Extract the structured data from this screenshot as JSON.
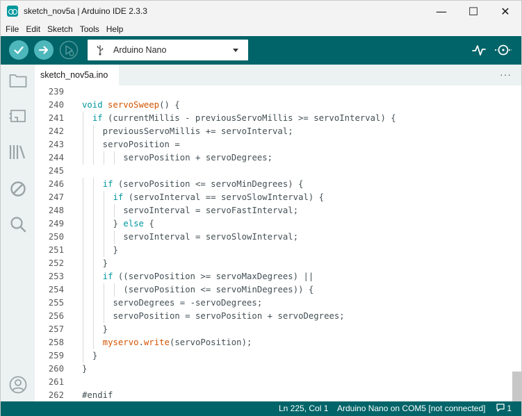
{
  "window": {
    "title": "sketch_nov5a | Arduino IDE 2.3.3",
    "controls": [
      "—",
      "☐",
      "✕"
    ]
  },
  "menu": [
    "File",
    "Edit",
    "Sketch",
    "Tools",
    "Help"
  ],
  "toolbar": {
    "board_name": "Arduino Nano",
    "icons": [
      "verify-icon",
      "upload-icon",
      "debug-icon",
      "serial-plotter-icon",
      "serial-monitor-icon"
    ]
  },
  "sidebar": {
    "icons": [
      "folder-icon",
      "boards-manager-icon",
      "library-manager-icon",
      "debug-off-icon",
      "search-icon",
      "account-icon"
    ]
  },
  "tabs": [
    {
      "label": "sketch_nov5a.ino"
    }
  ],
  "tab_more": "···",
  "colors": {
    "teal_dark": "#006468",
    "teal_light": "#4db7bb",
    "keyword": "#00979d",
    "function": "#d35400",
    "text": "#434f54"
  },
  "code": [
    {
      "n": "239",
      "indent": 0,
      "t": ""
    },
    {
      "n": "240",
      "indent": 0,
      "t": "void servoSweep() {"
    },
    {
      "n": "241",
      "indent": 1,
      "t": "if (currentMillis - previousServoMillis >= servoInterval) {"
    },
    {
      "n": "242",
      "indent": 2,
      "t": "previousServoMillis += servoInterval;"
    },
    {
      "n": "243",
      "indent": 2,
      "t": "servoPosition ="
    },
    {
      "n": "244",
      "indent": 4,
      "t": "servoPosition + servoDegrees;"
    },
    {
      "n": "245",
      "indent": 0,
      "t": ""
    },
    {
      "n": "246",
      "indent": 2,
      "t": "if (servoPosition <= servoMinDegrees) {"
    },
    {
      "n": "247",
      "indent": 3,
      "t": "if (servoInterval == servoSlowInterval) {"
    },
    {
      "n": "248",
      "indent": 4,
      "t": "servoInterval = servoFastInterval;"
    },
    {
      "n": "249",
      "indent": 3,
      "t": "} else {"
    },
    {
      "n": "250",
      "indent": 4,
      "t": "servoInterval = servoSlowInterval;"
    },
    {
      "n": "251",
      "indent": 3,
      "t": "}"
    },
    {
      "n": "252",
      "indent": 2,
      "t": "}"
    },
    {
      "n": "253",
      "indent": 2,
      "t": "if ((servoPosition >= servoMaxDegrees) ||"
    },
    {
      "n": "254",
      "indent": 4,
      "t": "(servoPosition <= servoMinDegrees)) {"
    },
    {
      "n": "255",
      "indent": 3,
      "t": "servoDegrees = -servoDegrees;"
    },
    {
      "n": "256",
      "indent": 3,
      "t": "servoPosition = servoPosition + servoDegrees;"
    },
    {
      "n": "257",
      "indent": 2,
      "t": "}"
    },
    {
      "n": "258",
      "indent": 2,
      "t": "myservo.write(servoPosition);"
    },
    {
      "n": "259",
      "indent": 1,
      "t": "}"
    },
    {
      "n": "260",
      "indent": 0,
      "t": "}"
    },
    {
      "n": "261",
      "indent": 0,
      "t": ""
    },
    {
      "n": "262",
      "indent": 0,
      "t": "#endif"
    }
  ],
  "status": {
    "cursor": "Ln 225, Col 1",
    "board_port": "Arduino Nano on COM5 [not connected]",
    "notifications": "1"
  }
}
